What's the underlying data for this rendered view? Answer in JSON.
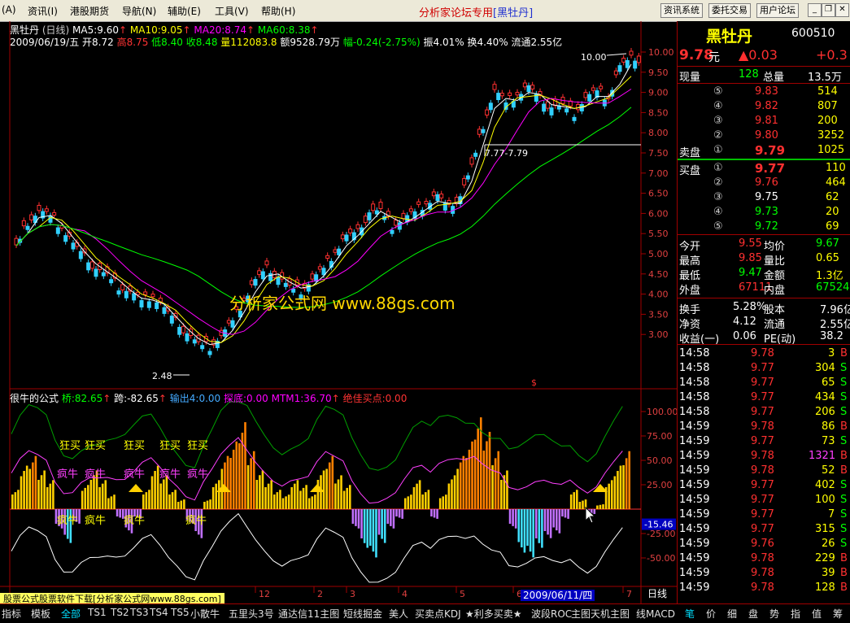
{
  "menu": {
    "items": [
      "(A)",
      "资讯(I)",
      "港股期货",
      "导航(N)",
      "辅助(E)",
      "工具(V)",
      "帮助(H)"
    ],
    "center_title": "分析家论坛专用",
    "center_tag": "[黑牡丹]",
    "tool_buttons": [
      "资讯系统",
      "委托交易",
      "用户论坛"
    ]
  },
  "chart_header": {
    "name": "黑牡丹",
    "period": "(日线)",
    "ma5": "MA5:9.60",
    "ma10": "MA10:9.05",
    "ma20": "MA20:8.74",
    "ma60": "MA60:8.38",
    "date": "2009/06/19/五",
    "open": "开8.72",
    "high": "高8.75",
    "low": "低8.40",
    "close": "收8.48",
    "vol": "量112083.8",
    "amount": "额9528.79万",
    "change": "幅-0.24(-2.75%)",
    "amplitude": "振4.01%",
    "turnover": "换4.40%",
    "float": "流通2.55亿"
  },
  "annotations": {
    "high_label": "10.00",
    "low_label": "2.48",
    "box_label": "7.77-7.79",
    "watermark": "分析家公式网 www.88gs.com",
    "dollar": "$"
  },
  "indicator_header": {
    "name": "很牛的公式",
    "bridge": "桥:82.65",
    "jump": "跨:-82.65",
    "output": "输出4:0.00",
    "probe": "探底:0.00",
    "mtm": "MTM1:36.70",
    "best_buy": "绝佳买点:0.00"
  },
  "indicator_labels": {
    "top": [
      "狂买",
      "狂买",
      "狂买",
      "狂买",
      "狂买"
    ],
    "mid": [
      "疯牛",
      "疯牛",
      "疯牛",
      "疯牛",
      "疯牛"
    ],
    "bot": [
      "疯牛",
      "疯牛",
      "疯牛",
      "疯牛"
    ]
  },
  "chart_data": {
    "type": "line",
    "title": "黑牡丹 (日线)",
    "price_axis": {
      "ticks": [
        "10.00",
        "9.50",
        "9.00",
        "8.50",
        "8.00",
        "7.50",
        "7.00",
        "6.50",
        "6.00",
        "5.50",
        "5.00",
        "4.50",
        "4.00",
        "3.50",
        "3.00"
      ],
      "ylim": [
        2.5,
        10.0
      ]
    },
    "close_series": [
      5.2,
      5.8,
      6.0,
      5.9,
      5.6,
      5.2,
      4.9,
      4.6,
      4.5,
      4.2,
      4.0,
      3.8,
      3.9,
      3.6,
      3.3,
      3.0,
      2.8,
      2.7,
      2.9,
      3.3,
      3.8,
      4.3,
      4.6,
      4.4,
      4.2,
      4.1,
      4.3,
      4.6,
      5.0,
      5.4,
      5.5,
      6.0,
      6.1,
      5.7,
      5.8,
      6.0,
      6.2,
      6.4,
      6.1,
      6.4,
      7.2,
      8.2,
      9.0,
      8.7,
      8.9,
      9.1,
      8.8,
      8.6,
      8.7,
      8.5,
      8.8,
      9.0,
      8.8,
      9.6,
      9.8
    ],
    "ma_series": [
      {
        "name": "MA5",
        "color": "#ffffff"
      },
      {
        "name": "MA10",
        "color": "#ffff00"
      },
      {
        "name": "MA20",
        "color": "#ff00ff"
      },
      {
        "name": "MA60",
        "color": "#00ff00"
      }
    ],
    "indicator_axis": {
      "ticks": [
        "100.00",
        "75.00",
        "50.00",
        "25.00",
        "-25.00",
        "-50.00"
      ],
      "ylim": [
        -75,
        110
      ],
      "current": "-15.46"
    },
    "histogram": [
      20,
      45,
      55,
      40,
      30,
      -20,
      -35,
      -15,
      25,
      40,
      30,
      15,
      -10,
      -25,
      -10,
      20,
      45,
      35,
      20,
      10,
      -15,
      -30,
      10,
      30,
      55,
      70,
      90,
      60,
      40,
      30,
      20,
      15,
      30,
      25,
      15,
      40,
      55,
      35,
      25,
      -20,
      -40,
      -50,
      -35,
      -20,
      -10,
      15,
      30,
      20,
      -10,
      15,
      35,
      55,
      70,
      95,
      80,
      60,
      40,
      -20,
      -45,
      -50,
      -40,
      -30,
      -25,
      -10,
      20,
      10,
      -5,
      5,
      30,
      45,
      60
    ]
  },
  "bottom_axis": {
    "labels": [
      "12",
      "2",
      "3",
      "4",
      "5",
      "6",
      "7"
    ],
    "date_badge": "2009/06/11/四",
    "period": "日线"
  },
  "quote": {
    "name": "黑牡丹",
    "code": "600510",
    "price": "9.78",
    "unit": "元",
    "change": "▲0.03",
    "change_pct": "+0.3",
    "vol_label": "现量",
    "vol_value": "128",
    "total_label": "总量",
    "total_value": "13.5万",
    "sell_label": "卖盘",
    "buy_label": "买盘",
    "sell": [
      {
        "lvl": "⑤",
        "price": "9.83",
        "vol": "514"
      },
      {
        "lvl": "④",
        "price": "9.82",
        "vol": "807"
      },
      {
        "lvl": "③",
        "price": "9.81",
        "vol": "200"
      },
      {
        "lvl": "②",
        "price": "9.80",
        "vol": "3252"
      },
      {
        "lvl": "①",
        "price": "9.79",
        "vol": "1025"
      }
    ],
    "buy": [
      {
        "lvl": "①",
        "price": "9.77",
        "vol": "110"
      },
      {
        "lvl": "②",
        "price": "9.76",
        "vol": "464"
      },
      {
        "lvl": "③",
        "price": "9.75",
        "vol": "62"
      },
      {
        "lvl": "④",
        "price": "9.73",
        "vol": "20"
      },
      {
        "lvl": "⑤",
        "price": "9.72",
        "vol": "69"
      }
    ],
    "stats": [
      {
        "k1": "今开",
        "v1": "9.55",
        "k2": "均价",
        "v2": "9.67"
      },
      {
        "k1": "最高",
        "v1": "9.85",
        "k2": "量比",
        "v2": "0.65"
      },
      {
        "k1": "最低",
        "v1": "9.47",
        "k2": "金额",
        "v2": "1.3亿"
      },
      {
        "k1": "外盘",
        "v1": "67111",
        "k2": "内盘",
        "v2": "67524"
      }
    ],
    "fund": [
      {
        "k1": "换手",
        "v1": "5.28%",
        "k2": "股本",
        "v2": "7.96亿"
      },
      {
        "k1": "净资",
        "v1": "4.12",
        "k2": "流通",
        "v2": "2.55亿"
      },
      {
        "k1": "收益(一)",
        "v1": "0.06",
        "k2": "PE(动)",
        "v2": "38.2"
      }
    ],
    "ticks": [
      {
        "t": "14:58",
        "p": "9.78",
        "v": "3",
        "d": "B"
      },
      {
        "t": "14:58",
        "p": "9.77",
        "v": "304",
        "d": "S"
      },
      {
        "t": "14:58",
        "p": "9.77",
        "v": "65",
        "d": "S"
      },
      {
        "t": "14:58",
        "p": "9.77",
        "v": "434",
        "d": "S"
      },
      {
        "t": "14:58",
        "p": "9.77",
        "v": "206",
        "d": "S"
      },
      {
        "t": "14:59",
        "p": "9.78",
        "v": "86",
        "d": "B"
      },
      {
        "t": "14:59",
        "p": "9.77",
        "v": "73",
        "d": "S"
      },
      {
        "t": "14:59",
        "p": "9.78",
        "v": "1321",
        "d": "B"
      },
      {
        "t": "14:59",
        "p": "9.78",
        "v": "52",
        "d": "B"
      },
      {
        "t": "14:59",
        "p": "9.77",
        "v": "402",
        "d": "S"
      },
      {
        "t": "14:59",
        "p": "9.77",
        "v": "100",
        "d": "S"
      },
      {
        "t": "14:59",
        "p": "9.77",
        "v": "7",
        "d": "S"
      },
      {
        "t": "14:59",
        "p": "9.77",
        "v": "315",
        "d": "S"
      },
      {
        "t": "14:59",
        "p": "9.76",
        "v": "26",
        "d": "S"
      },
      {
        "t": "14:59",
        "p": "9.78",
        "v": "229",
        "d": "B"
      },
      {
        "t": "14:59",
        "p": "9.78",
        "v": "39",
        "d": "B"
      },
      {
        "t": "14:59",
        "p": "9.78",
        "v": "128",
        "d": "B"
      }
    ]
  },
  "bottom_tabs": [
    "指标",
    "模板",
    "全部",
    "TS1",
    "TS2",
    "TS3",
    "TS4",
    "TS5",
    "小散牛",
    "五里头3号",
    "通达信11主图",
    "短线掘金",
    "美人",
    "买卖点KDJ",
    "★利多买卖★",
    "波段ROC",
    "主图天机主图",
    "线MACD"
  ],
  "right_tabs": [
    "笔",
    "价",
    "细",
    "盘",
    "势",
    "指",
    "值",
    "筹"
  ],
  "site_banner": "股票公式股票软件下载[分析家公式网www.88gs.com]"
}
